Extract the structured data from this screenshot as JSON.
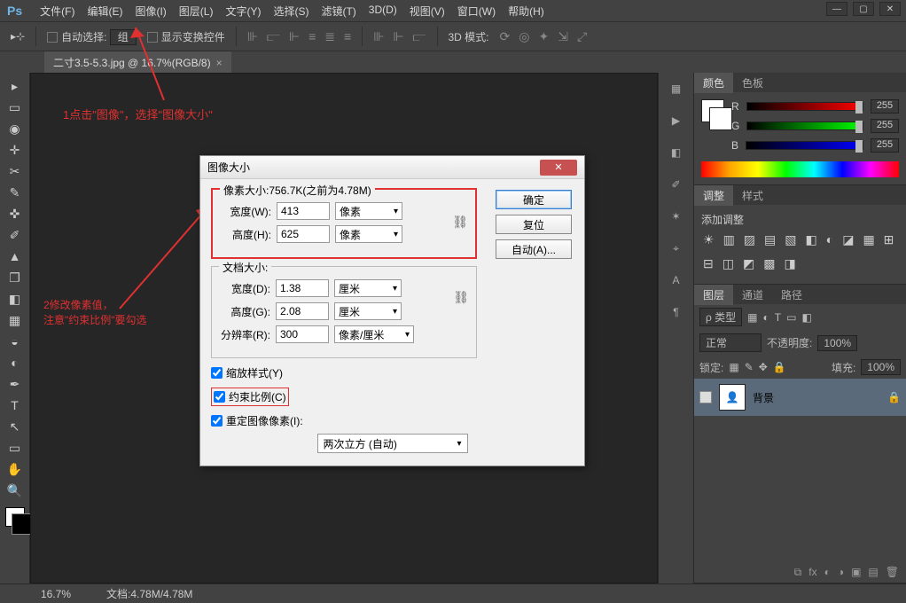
{
  "app": {
    "logo": "Ps"
  },
  "menu": [
    "文件(F)",
    "编辑(E)",
    "图像(I)",
    "图层(L)",
    "文字(Y)",
    "选择(S)",
    "滤镜(T)",
    "3D(D)",
    "视图(V)",
    "窗口(W)",
    "帮助(H)"
  ],
  "optbar": {
    "auto_select": "自动选择:",
    "group": "组",
    "show_transform": "显示变换控件",
    "mode3d": "3D 模式:"
  },
  "doctab": {
    "title": "二寸3.5-5.3.jpg @ 16.7%(RGB/8)",
    "close": "×"
  },
  "annotations": {
    "a1": "1点击\"图像\"，选择\"图像大小\"",
    "a2_line1": "2修改像素值，",
    "a2_line2": "注意\"约束比例\"要勾选"
  },
  "status": {
    "zoom": "16.7%",
    "docsize_label": "文档:",
    "docsize": "4.78M/4.78M"
  },
  "dialog": {
    "title": "图像大小",
    "pixel_legend": "像素大小:756.7K(之前为4.78M)",
    "width_label": "宽度(W):",
    "width_val": "413",
    "width_unit": "像素",
    "height_label": "高度(H):",
    "height_val": "625",
    "height_unit": "像素",
    "doc_legend": "文档大小:",
    "dwidth_label": "宽度(D):",
    "dwidth_val": "1.38",
    "dwidth_unit": "厘米",
    "dheight_label": "高度(G):",
    "dheight_val": "2.08",
    "dheight_unit": "厘米",
    "res_label": "分辨率(R):",
    "res_val": "300",
    "res_unit": "像素/厘米",
    "scale_styles": "缩放样式(Y)",
    "constrain": "约束比例(C)",
    "resample": "重定图像像素(I):",
    "interp": "两次立方 (自动)",
    "ok": "确定",
    "reset": "复位",
    "auto": "自动(A)..."
  },
  "panels": {
    "color_tab": "颜色",
    "swatch_tab": "色板",
    "r_label": "R",
    "g_label": "G",
    "b_label": "B",
    "r_val": "255",
    "g_val": "255",
    "b_val": "255",
    "adjust_tab": "调整",
    "styles_tab": "样式",
    "add_adjust": "添加调整",
    "layers_tab": "图层",
    "channels_tab": "通道",
    "paths_tab": "路径",
    "kind": "ρ 类型",
    "blend": "正常",
    "opacity_label": "不透明度:",
    "opacity_val": "100%",
    "lock_label": "锁定:",
    "fill_label": "填充:",
    "fill_val": "100%",
    "layer_name": "背景"
  }
}
